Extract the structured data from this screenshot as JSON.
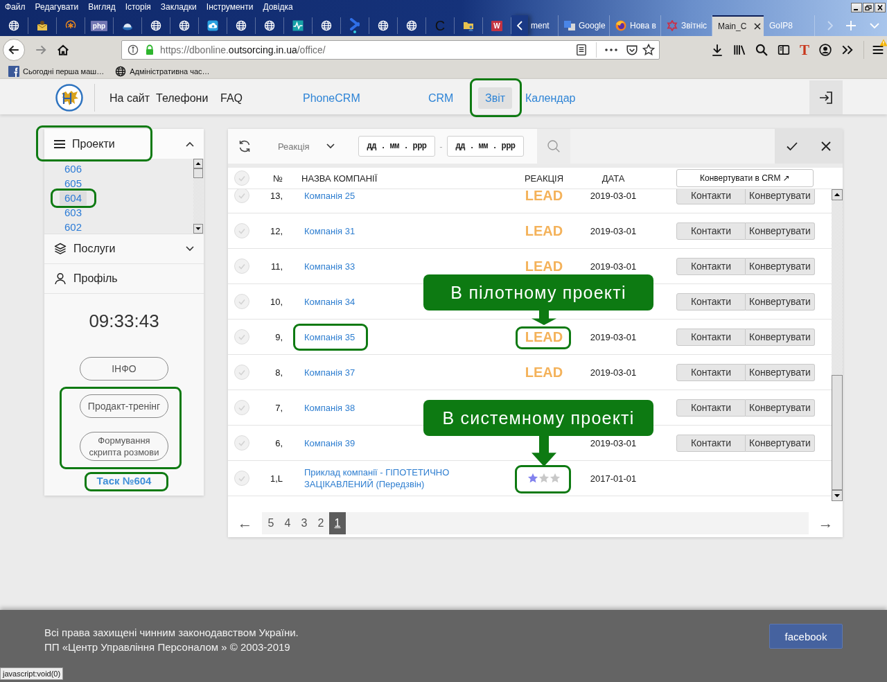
{
  "browser": {
    "menu": [
      "Файл",
      "Редагувати",
      "Вигляд",
      "Історія",
      "Закладки",
      "Інструменти",
      "Довідка"
    ],
    "pinned_tabs": [
      {
        "kind": "globe"
      },
      {
        "kind": "mail"
      },
      {
        "kind": "asterisk"
      },
      {
        "kind": "tile",
        "text": "php",
        "color": "#7377b3"
      },
      {
        "kind": "dome"
      },
      {
        "kind": "globe"
      },
      {
        "kind": "globe"
      },
      {
        "kind": "cloud"
      },
      {
        "kind": "globe"
      },
      {
        "kind": "globe"
      },
      {
        "kind": "pulse"
      },
      {
        "kind": "globe"
      },
      {
        "kind": "bowtie"
      },
      {
        "kind": "globe"
      },
      {
        "kind": "globe"
      },
      {
        "kind": "letter",
        "text": "C"
      },
      {
        "kind": "folder"
      },
      {
        "kind": "tile",
        "text": "W",
        "color": "#c33343"
      }
    ],
    "tabs": [
      {
        "kind": "plain",
        "label": "ment",
        "selected": false
      },
      {
        "kind": "tiles",
        "label": "Google",
        "selected": false
      },
      {
        "kind": "flame",
        "label": "Нова в",
        "selected": false
      },
      {
        "kind": "ring",
        "label": "Звітніс",
        "selected": false
      },
      {
        "kind": "plain",
        "label": "Main_C",
        "selected": true
      },
      {
        "kind": "plain",
        "label": "GoIP8",
        "selected": false
      }
    ],
    "url": {
      "prefix": "https://dbonline.",
      "domain": "outsorcing.in.ua",
      "path": "/office/"
    },
    "extension_letter": "T",
    "bookmarks": [
      {
        "kind": "facebook",
        "label": "Сьогодні перша маш…"
      },
      {
        "kind": "globe",
        "label": "Адміністративна час…"
      }
    ],
    "status_url": "javascript:void(0)"
  },
  "app": {
    "nav": [
      {
        "kind": "static",
        "label": "На сайт",
        "selected": false,
        "highlighted": false
      },
      {
        "kind": "static",
        "label": "Телефони",
        "selected": false,
        "highlighted": false
      },
      {
        "kind": "static",
        "label": "FAQ",
        "selected": false,
        "highlighted": false
      },
      {
        "kind": "module",
        "label": "PhoneCRM",
        "selected": false,
        "highlighted": false
      },
      {
        "kind": "module",
        "label": "CRM",
        "selected": false,
        "highlighted": false
      },
      {
        "kind": "module",
        "label": "Звіт",
        "selected": true,
        "highlighted": true
      },
      {
        "kind": "module",
        "label": "Календар",
        "selected": false,
        "highlighted": false
      }
    ],
    "sidebar": {
      "projects": {
        "label": "Проекти",
        "expanded": true,
        "highlighted": true,
        "items": [
          {
            "label": "606",
            "selected": false,
            "highlighted": false
          },
          {
            "label": "605",
            "selected": false,
            "highlighted": false
          },
          {
            "label": "604",
            "selected": true,
            "highlighted": true
          },
          {
            "label": "603",
            "selected": false,
            "highlighted": false
          },
          {
            "label": "602",
            "selected": false,
            "highlighted": false
          }
        ]
      },
      "services": {
        "label": "Послуги",
        "expanded": false
      },
      "profile": {
        "label": "Профіль"
      },
      "clock": "09:33:43",
      "info_button": "ІНФО",
      "training": {
        "highlighted": true,
        "buttons": [
          "Продакт-тренінг",
          "Формування скрипта розмови"
        ]
      },
      "task_link": {
        "label": "Таск №604",
        "highlighted": true
      }
    },
    "filters": {
      "reaction": {
        "placeholder": "Реакція"
      },
      "date_from": {
        "placeholder": "дд . мм . ррр"
      },
      "date_separator": "-",
      "date_to": {
        "placeholder": "дд . мм . ррр"
      }
    },
    "table": {
      "select_all_checked": false,
      "columns": [
        "№",
        "НАЗВА КОМПАНІЇ",
        "РЕАКЦІЯ",
        "ДАТА"
      ],
      "bulk_button": "Конвертувати в CRM ↗",
      "rows": [
        {
          "checked": false,
          "number": "13,",
          "name": "Компанія 25",
          "name_highlighted": false,
          "reaction": {
            "kind": "label",
            "text": "LEAD",
            "highlighted": false
          },
          "date": "2019-03-01",
          "actions": [
            "Контакти",
            "Конвертувати"
          ]
        },
        {
          "checked": false,
          "number": "12,",
          "name": "Компанія 31",
          "name_highlighted": false,
          "reaction": {
            "kind": "label",
            "text": "LEAD",
            "highlighted": false
          },
          "date": "2019-03-01",
          "actions": [
            "Контакти",
            "Конвертувати"
          ]
        },
        {
          "checked": false,
          "number": "11,",
          "name": "Компанія 33",
          "name_highlighted": false,
          "reaction": {
            "kind": "label",
            "text": "LEAD",
            "highlighted": false
          },
          "date": "2019-03-01",
          "actions": [
            "Контакти",
            "Конвертувати"
          ]
        },
        {
          "checked": false,
          "number": "10,",
          "name": "Компанія 34",
          "name_highlighted": false,
          "actions": [
            "Контакти",
            "Конвертувати"
          ]
        },
        {
          "checked": false,
          "number": "9,",
          "name": "Компанія 35",
          "name_highlighted": true,
          "reaction": {
            "kind": "label",
            "text": "LEAD",
            "highlighted": true
          },
          "date": "2019-03-01",
          "actions": [
            "Контакти",
            "Конвертувати"
          ],
          "callout": "В пілотному проекті"
        },
        {
          "checked": false,
          "number": "8,",
          "name": "Компанія 37",
          "name_highlighted": false,
          "reaction": {
            "kind": "label",
            "text": "LEAD",
            "highlighted": false
          },
          "date": "2019-03-01",
          "actions": [
            "Контакти",
            "Конвертувати"
          ]
        },
        {
          "checked": false,
          "number": "7,",
          "name": "Компанія 38",
          "name_highlighted": false,
          "actions": [
            "Контакти",
            "Конвертувати"
          ]
        },
        {
          "checked": false,
          "number": "6,",
          "name": "Компанія 39",
          "name_highlighted": false,
          "date": "2019-03-01",
          "actions": [
            "Контакти",
            "Конвертувати"
          ]
        },
        {
          "checked": false,
          "number": "1,L",
          "name": "Приклад компанії - ГІПОТЕТИЧНО ЗАЦІКАВЛЕНИЙ (Передзвін)",
          "name_highlighted": false,
          "reaction": {
            "kind": "stars",
            "stars": 1,
            "highlighted": true
          },
          "date": "2017-01-01",
          "callout": "В системному проекті"
        }
      ]
    },
    "pagination": {
      "prev": "←",
      "pages": [
        {
          "label": "5",
          "selected": false
        },
        {
          "label": "4",
          "selected": false
        },
        {
          "label": "3",
          "selected": false
        },
        {
          "label": "2",
          "selected": false
        },
        {
          "label": "1",
          "selected": true
        }
      ],
      "next": "→"
    },
    "footer": {
      "lines": [
        "Всі права захищені чинним законодавством України.",
        "ПП «Центр Управління Персоналом » © 2003-2019"
      ],
      "facebook_button": "facebook"
    }
  }
}
